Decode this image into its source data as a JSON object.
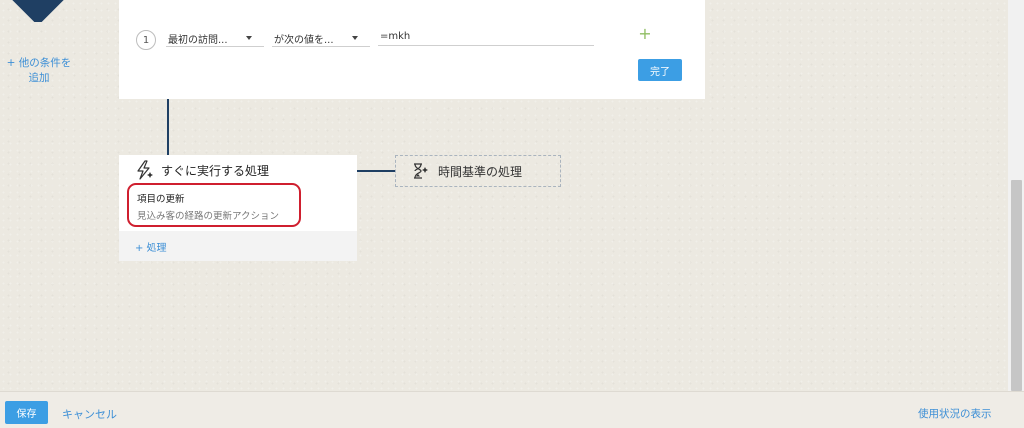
{
  "sidebar": {
    "add_condition_line1": "+ 他の条件を",
    "add_condition_line2": "追加"
  },
  "criteria": {
    "row_number": "1",
    "field_label": "最初の訪問...",
    "operator_label": "が次の値を...",
    "value": "=mkh",
    "add_icon": "plus-icon",
    "done_label": "完了"
  },
  "immediate_actions": {
    "title": "すぐに実行する処理",
    "icon": "lightning-bolt-icon",
    "action_title": "項目の更新",
    "action_subtitle": "見込み客の経路の更新アクション",
    "add_action_label": "+ 処理"
  },
  "time_based_actions": {
    "label": "時間基準の処理",
    "icon": "hourglass-icon"
  },
  "footer": {
    "save_label": "保存",
    "cancel_label": "キャンセル",
    "usage_label": "使用状況の表示"
  },
  "colors": {
    "accent": "#3c9ee4",
    "link": "#3d8fd6",
    "connector": "#1f3f63",
    "highlight": "#cf1f2f",
    "add_green": "#8fbe62"
  }
}
